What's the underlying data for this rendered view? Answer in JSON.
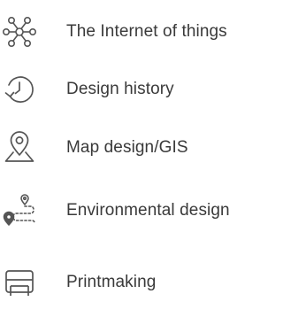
{
  "topics": [
    {
      "label": "The Internet of things",
      "icon": "network-nodes-icon"
    },
    {
      "label": "Design history",
      "icon": "history-clock-icon"
    },
    {
      "label": "Map design/GIS",
      "icon": "map-pin-icon"
    },
    {
      "label": "Environmental design",
      "icon": "route-pin-icon"
    },
    {
      "label": "Printmaking",
      "icon": "printer-icon"
    }
  ],
  "colors": {
    "icon_stroke": "#555555",
    "text": "#3a3a3a",
    "background": "#ffffff"
  }
}
